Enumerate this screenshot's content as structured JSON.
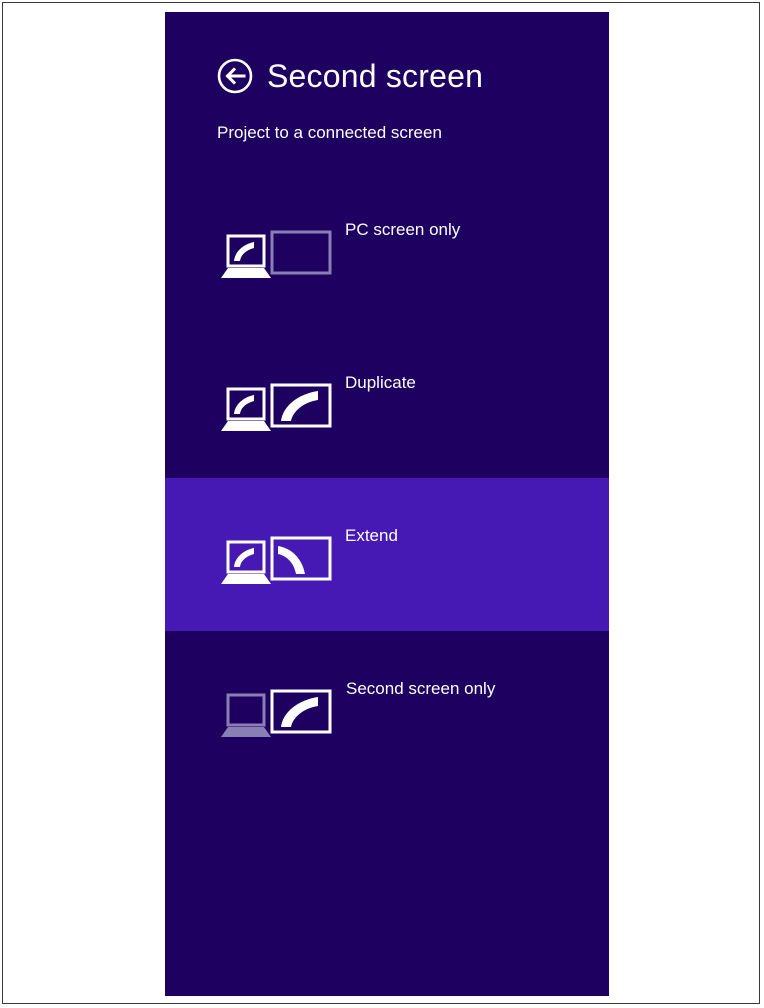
{
  "header": {
    "title": "Second screen",
    "subtitle": "Project to a connected screen"
  },
  "options": [
    {
      "label": "PC screen only",
      "icon": "pc-screen-only-icon"
    },
    {
      "label": "Duplicate",
      "icon": "duplicate-icon"
    },
    {
      "label": "Extend",
      "icon": "extend-icon",
      "selected": true
    },
    {
      "label": "Second screen only",
      "icon": "second-screen-only-icon"
    }
  ],
  "colors": {
    "panel_background": "#1d0060",
    "selected_background": "#4618b4",
    "foreground": "#ffffff",
    "dimmed": "#8a7fb4"
  }
}
